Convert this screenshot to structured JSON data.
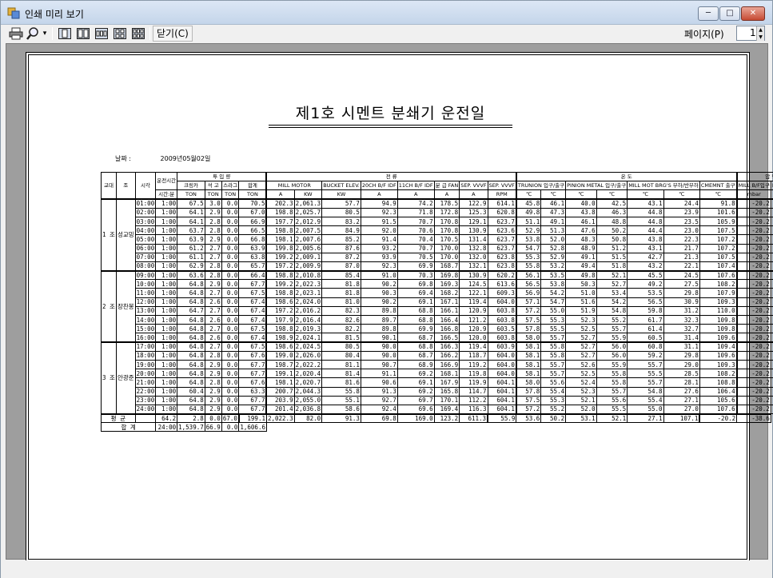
{
  "window": {
    "title": "인쇄 미리 보기",
    "minimize": "─",
    "maximize": "□",
    "close": "✕"
  },
  "toolbar": {
    "print_icon": "printer-icon",
    "zoom_icon": "magnifier-icon",
    "close_label": "닫기(C)",
    "page_label": "페이지(P)",
    "page_value": "1",
    "spin_up": "▲",
    "spin_down": "▼",
    "dropdown": "▾"
  },
  "report": {
    "title": "제1호   시멘트 분쇄기 운전일",
    "date_label": "날짜 :",
    "date_value": "2009년05월02일",
    "header": {
      "col_group": "교대",
      "col_group2": "조",
      "col_time": "시각",
      "runtime": "운전시간",
      "runtime_unit": "시간:분",
      "prod_group": "투 입 량",
      "prod_cols": [
        "크링카",
        "석 고",
        "스라그",
        "합계"
      ],
      "prod_unit": "TON",
      "elec_group": "전 류",
      "mill_motor": "MILL MOTOR",
      "elec_units": [
        "A",
        "KW"
      ],
      "elec_cols": [
        "BUCKET ELEV.",
        "20CH B/F IDF",
        "11CH B/F IDF",
        "분 급 FAN",
        "SEP. VVVF",
        "SEP. VVVF"
      ],
      "elec_col_units": [
        "KW",
        "A",
        "A",
        "A",
        "A",
        "RPM"
      ],
      "temp_group": "온 도",
      "temp_sub": [
        "TRUNION",
        "PINION METAL",
        "MILL MOT BRG'S",
        "CMEMNT"
      ],
      "temp_cols": [
        "입구",
        "출구",
        "입구",
        "출구",
        "부하",
        "반부하",
        "출구"
      ],
      "temp_unit": "℃",
      "press_group": "압 력",
      "press_cols": [
        "MILL B/F입구",
        "MILL B/F출구"
      ],
      "press_unit": "mbar"
    },
    "shifts": [
      {
        "no": "1",
        "suffix": "조",
        "name": "성교밍"
      },
      {
        "no": "2",
        "suffix": "조",
        "name": "장찬봉"
      },
      {
        "no": "3",
        "suffix": "조",
        "name": "안광준"
      }
    ],
    "rows": [
      [
        "01:00",
        "1:00",
        "67.5",
        "3.0",
        "0.0",
        "70.5",
        "202.3",
        "2,061.3",
        "57.7",
        "94.9",
        "74.2",
        "178.5",
        "122.9",
        "614.1",
        "45.8",
        "46.1",
        "40.0",
        "42.5",
        "43.1",
        "24.4",
        "91.8",
        "-20.2",
        "-40.1"
      ],
      [
        "02:00",
        "1:00",
        "64.1",
        "2.9",
        "0.0",
        "67.0",
        "198.8",
        "2,025.7",
        "80.5",
        "92.3",
        "71.8",
        "172.8",
        "125.3",
        "620.8",
        "49.8",
        "47.3",
        "43.8",
        "46.3",
        "44.8",
        "23.9",
        "101.6",
        "-20.2",
        "-38.6"
      ],
      [
        "03:00",
        "1:00",
        "64.1",
        "2.8",
        "0.0",
        "66.9",
        "197.7",
        "2,012.9",
        "83.2",
        "91.5",
        "70.7",
        "170.8",
        "129.1",
        "623.7",
        "51.1",
        "49.1",
        "46.1",
        "48.8",
        "44.8",
        "23.5",
        "105.9",
        "-20.2",
        "-38.3"
      ],
      [
        "04:00",
        "1:00",
        "63.7",
        "2.8",
        "0.0",
        "66.5",
        "198.8",
        "2,007.5",
        "84.9",
        "92.0",
        "70.6",
        "170.8",
        "130.9",
        "623.6",
        "52.9",
        "51.3",
        "47.6",
        "50.2",
        "44.4",
        "23.0",
        "107.5",
        "-20.2",
        "-38.1"
      ],
      [
        "05:00",
        "1:00",
        "63.9",
        "2.9",
        "0.0",
        "66.8",
        "198.1",
        "2,007.6",
        "85.2",
        "91.4",
        "70.4",
        "170.5",
        "131.4",
        "623.7",
        "53.8",
        "52.0",
        "48.3",
        "50.8",
        "43.8",
        "22.3",
        "107.2",
        "-20.2",
        "-38.1"
      ],
      [
        "06:00",
        "1:00",
        "61.2",
        "2.7",
        "0.0",
        "63.9",
        "199.8",
        "2,005.6",
        "87.6",
        "93.2",
        "70.7",
        "170.0",
        "132.8",
        "623.7",
        "54.7",
        "52.8",
        "48.9",
        "51.2",
        "43.1",
        "21.7",
        "107.2",
        "-20.2",
        "-38.2"
      ],
      [
        "07:00",
        "1:00",
        "61.1",
        "2.7",
        "0.0",
        "63.8",
        "199.2",
        "2,009.1",
        "87.2",
        "93.9",
        "70.5",
        "170.0",
        "132.0",
        "623.8",
        "55.3",
        "52.9",
        "49.1",
        "51.5",
        "42.7",
        "21.3",
        "107.5",
        "-20.2",
        "-38.1"
      ],
      [
        "08:00",
        "1:00",
        "62.9",
        "2.8",
        "0.0",
        "65.7",
        "197.2",
        "2,009.9",
        "87.0",
        "92.3",
        "69.9",
        "168.7",
        "132.1",
        "623.8",
        "55.8",
        "53.2",
        "49.4",
        "51.8",
        "43.2",
        "22.1",
        "107.4",
        "-20.2",
        "-38.1"
      ],
      [
        "09:00",
        "1:00",
        "63.6",
        "2.8",
        "0.0",
        "66.4",
        "198.8",
        "2,010.8",
        "85.4",
        "91.0",
        "70.3",
        "169.8",
        "130.9",
        "620.2",
        "56.1",
        "53.5",
        "49.8",
        "52.1",
        "45.5",
        "24.5",
        "107.6",
        "-20.2",
        "-38.0"
      ],
      [
        "10:00",
        "1:00",
        "64.8",
        "2.9",
        "0.0",
        "67.7",
        "199.2",
        "2,022.3",
        "81.8",
        "90.2",
        "69.8",
        "169.3",
        "124.5",
        "613.6",
        "56.5",
        "53.8",
        "50.3",
        "52.7",
        "49.2",
        "27.5",
        "108.2",
        "-20.2",
        "-38.8"
      ],
      [
        "11:00",
        "1:00",
        "64.8",
        "2.7",
        "0.0",
        "67.5",
        "198.8",
        "2,023.1",
        "81.8",
        "90.3",
        "69.4",
        "168.2",
        "122.1",
        "609.3",
        "56.9",
        "54.2",
        "51.0",
        "53.4",
        "53.5",
        "29.8",
        "107.9",
        "-20.2",
        "-38.8"
      ],
      [
        "12:00",
        "1:00",
        "64.8",
        "2.6",
        "0.0",
        "67.4",
        "198.6",
        "2,024.0",
        "81.0",
        "90.2",
        "69.1",
        "167.1",
        "119.4",
        "604.0",
        "57.1",
        "54.7",
        "51.6",
        "54.2",
        "56.5",
        "30.9",
        "109.3",
        "-20.2",
        "-38.8"
      ],
      [
        "13:00",
        "1:00",
        "64.7",
        "2.7",
        "0.0",
        "67.4",
        "197.2",
        "2,016.2",
        "82.3",
        "89.8",
        "68.8",
        "166.1",
        "120.9",
        "603.8",
        "57.2",
        "55.0",
        "51.9",
        "54.8",
        "59.8",
        "31.2",
        "110.0",
        "-20.2",
        "-38.7"
      ],
      [
        "14:00",
        "1:00",
        "64.8",
        "2.6",
        "0.0",
        "67.4",
        "197.9",
        "2,016.4",
        "82.6",
        "89.7",
        "68.8",
        "166.4",
        "121.2",
        "603.8",
        "57.5",
        "55.3",
        "52.3",
        "55.2",
        "61.7",
        "32.3",
        "109.8",
        "-20.2",
        "-38.8"
      ],
      [
        "15:00",
        "1:00",
        "64.8",
        "2.7",
        "0.0",
        "67.5",
        "198.8",
        "2,019.3",
        "82.2",
        "89.8",
        "69.9",
        "166.8",
        "120.9",
        "603.5",
        "57.8",
        "55.5",
        "52.5",
        "55.7",
        "61.4",
        "32.7",
        "109.8",
        "-20.2",
        "-38.8"
      ],
      [
        "16:00",
        "1:00",
        "64.8",
        "2.6",
        "0.0",
        "67.4",
        "198.9",
        "2,024.1",
        "81.5",
        "90.1",
        "68.7",
        "166.5",
        "120.0",
        "603.8",
        "58.0",
        "55.7",
        "52.7",
        "55.9",
        "60.5",
        "31.4",
        "109.6",
        "-20.2",
        "-38.8"
      ],
      [
        "17:00",
        "1:00",
        "64.8",
        "2.7",
        "0.0",
        "67.5",
        "198.6",
        "2,024.5",
        "80.5",
        "90.0",
        "68.8",
        "166.3",
        "119.4",
        "603.9",
        "58.1",
        "55.8",
        "52.7",
        "56.0",
        "60.8",
        "31.1",
        "109.4",
        "-20.2",
        "-38.9"
      ],
      [
        "18:00",
        "1:00",
        "64.8",
        "2.8",
        "0.0",
        "67.6",
        "199.0",
        "2,026.0",
        "80.4",
        "90.0",
        "68.7",
        "166.2",
        "118.7",
        "604.0",
        "58.1",
        "55.8",
        "52.7",
        "56.0",
        "59.2",
        "29.8",
        "109.6",
        "-20.2",
        "-38.9"
      ],
      [
        "19:00",
        "1:00",
        "64.8",
        "2.9",
        "0.0",
        "67.7",
        "198.7",
        "2,022.2",
        "81.1",
        "90.7",
        "68.9",
        "166.9",
        "119.2",
        "604.0",
        "58.1",
        "55.7",
        "52.6",
        "55.9",
        "55.7",
        "29.0",
        "109.3",
        "-20.2",
        "-38.8"
      ],
      [
        "20:00",
        "1:00",
        "64.8",
        "2.9",
        "0.0",
        "67.7",
        "199.1",
        "2,020.4",
        "81.4",
        "91.1",
        "69.2",
        "168.1",
        "119.8",
        "604.0",
        "58.1",
        "55.7",
        "52.5",
        "55.8",
        "55.5",
        "28.5",
        "108.2",
        "-20.2",
        "-38.0"
      ],
      [
        "21:00",
        "1:00",
        "64.8",
        "2.8",
        "0.0",
        "67.6",
        "198.1",
        "2,020.7",
        "81.6",
        "90.6",
        "69.1",
        "167.9",
        "119.9",
        "604.1",
        "58.0",
        "55.6",
        "52.4",
        "55.8",
        "55.7",
        "28.1",
        "108.8",
        "-20.2",
        "-38.1"
      ],
      [
        "22:00",
        "1:00",
        "60.4",
        "2.9",
        "0.0",
        "63.3",
        "200.7",
        "2,044.3",
        "55.8",
        "91.3",
        "69.2",
        "165.8",
        "114.7",
        "604.1",
        "57.8",
        "55.4",
        "52.3",
        "55.7",
        "54.8",
        "27.6",
        "106.4",
        "-20.2",
        "-37.0"
      ],
      [
        "23:00",
        "1:00",
        "64.8",
        "2.9",
        "0.0",
        "67.7",
        "203.9",
        "2,055.0",
        "55.1",
        "92.7",
        "69.7",
        "170.1",
        "112.2",
        "604.1",
        "57.5",
        "55.3",
        "52.1",
        "55.6",
        "55.4",
        "27.1",
        "105.6",
        "-20.2",
        "-38.8"
      ],
      [
        "24:00",
        "1:00",
        "64.8",
        "2.9",
        "0.0",
        "67.7",
        "201.4",
        "2,036.8",
        "58.6",
        "92.4",
        "69.6",
        "169.4",
        "116.3",
        "604.1",
        "57.2",
        "55.2",
        "52.0",
        "55.5",
        "55.0",
        "27.0",
        "107.6",
        "-20.2",
        "-38.9"
      ]
    ],
    "avg_label": "평 균",
    "avg": [
      "",
      "64.2",
      "2.8",
      "0.0",
      "67.0",
      "199.1",
      "2,022.3",
      "82.0",
      "91.3",
      "69.8",
      "169.0",
      "123.2",
      "611.3",
      "55.9",
      "53.6",
      "50.2",
      "53.1",
      "52.1",
      "27.1",
      "107.1",
      "-20.2",
      "-38.6"
    ],
    "sum_label": "합 계",
    "sum": [
      "24:00",
      "1,539.7",
      "66.9",
      "0.0",
      "1,606.6"
    ]
  }
}
